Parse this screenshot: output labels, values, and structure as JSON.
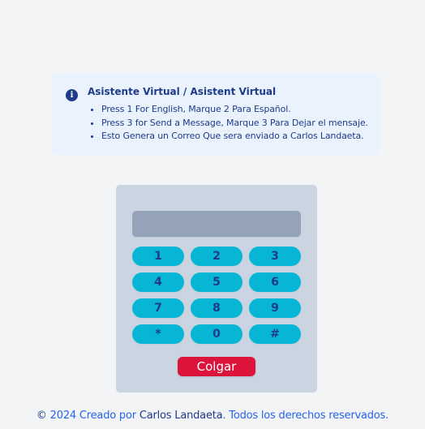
{
  "alert": {
    "icon": "info-circle-icon",
    "title": "Asistente Virtual / Asistent Virtual",
    "items": [
      "Press 1 For English, Marque 2 Para Español.",
      "Press 3 for Send a Message, Marque 3 Para Dejar el mensaje.",
      "Esto Genera un Correo Que sera enviado a Carlos Landaeta."
    ]
  },
  "dialer": {
    "display_value": "",
    "keys": [
      "1",
      "2",
      "3",
      "4",
      "5",
      "6",
      "7",
      "8",
      "9",
      "*",
      "0",
      "#"
    ],
    "hangup_label": "Colgar"
  },
  "footer": {
    "copyright": "©",
    "year_text": "2024 Creado por",
    "author": "Carlos Landaeta",
    "rights": ". Todos los derechos reservados."
  },
  "colors": {
    "key_bg": "#06b6d4",
    "hangup_bg": "#dc143c",
    "text_dark_blue": "#1e3a8a",
    "link_blue": "#2563eb"
  }
}
